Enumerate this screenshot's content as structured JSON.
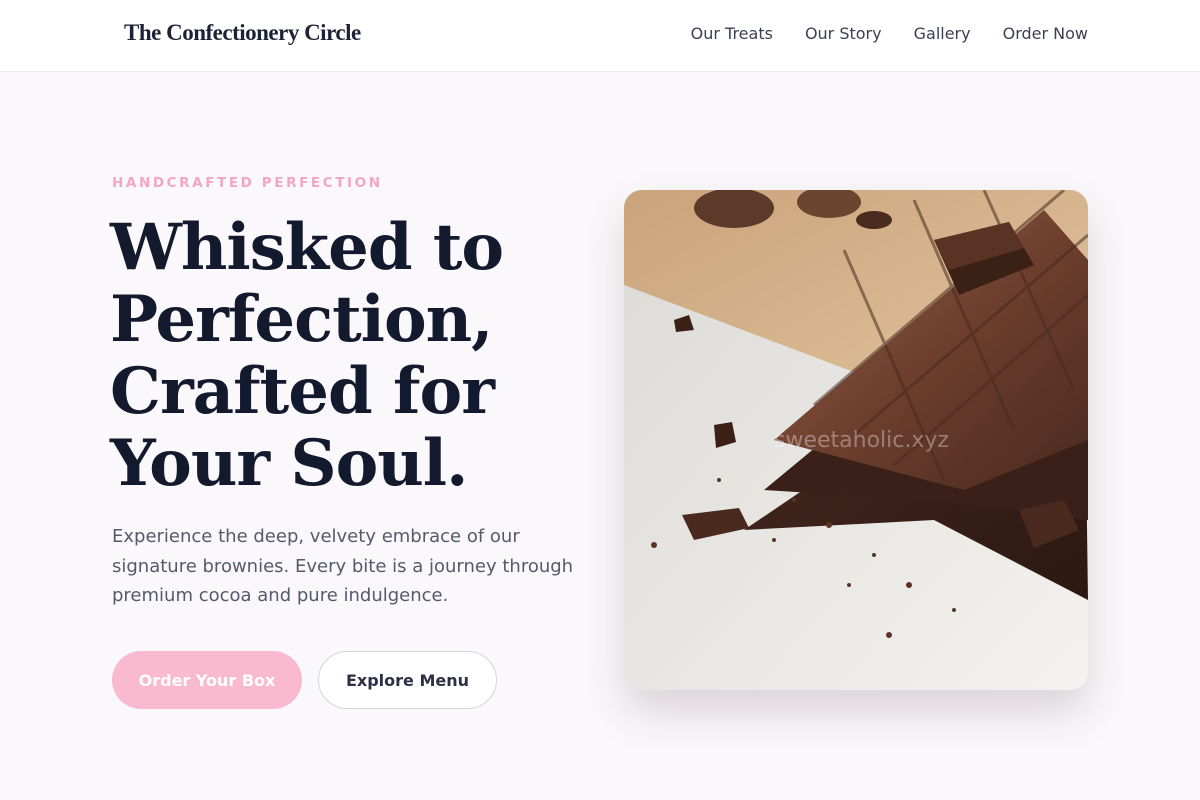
{
  "header": {
    "brand": "The Confectionery Circle",
    "nav": [
      {
        "label": "Our Treats"
      },
      {
        "label": "Our Story"
      },
      {
        "label": "Gallery"
      },
      {
        "label": "Order Now"
      }
    ]
  },
  "hero": {
    "eyebrow": "HANDCRAFTED PERFECTION",
    "title_lines": [
      "Whisked to",
      "Perfection,",
      "Crafted for",
      "Your Soul."
    ],
    "description": "Experience the deep, velvety embrace of our signature brownies. Every bite is a journey through premium cocoa and pure indulgence.",
    "primary_button": "Order Your Box",
    "secondary_button": "Explore Menu",
    "image": {
      "watermark": "sweetaholic.xyz",
      "icon": "chocolate-bars-photo"
    }
  },
  "colors": {
    "background": "#fbf8fb",
    "accent_pink": "#f9b9cf",
    "eyebrow_pink": "#f3a6c3",
    "heading": "#141a2e",
    "body_text": "#555a6b"
  }
}
